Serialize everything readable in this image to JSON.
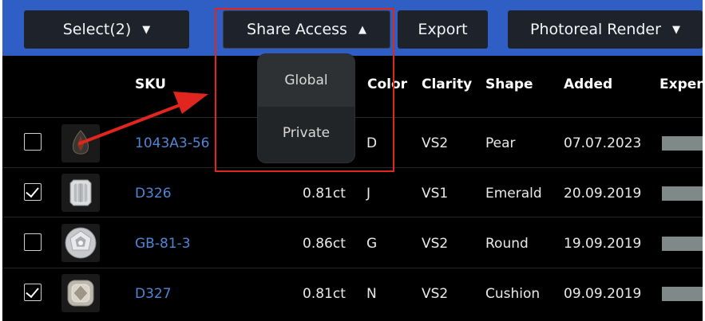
{
  "toolbar": {
    "select_label": "Select(2)",
    "share_label": "Share Access",
    "export_label": "Export",
    "render_label": "Photoreal Render"
  },
  "share_menu": {
    "items": [
      {
        "label": "Global"
      },
      {
        "label": "Private"
      }
    ]
  },
  "table": {
    "columns": {
      "sku": "SKU",
      "color": "Color",
      "clarity": "Clarity",
      "shape": "Shape",
      "added": "Added",
      "expen": "Expen"
    },
    "rows": [
      {
        "checked": false,
        "sku": "1043A3-56",
        "carat": "",
        "color": "D",
        "clarity": "VS2",
        "shape": "Pear",
        "added": "07.07.2023",
        "thumb": "pear-diamond-thumbnail"
      },
      {
        "checked": true,
        "sku": "D326",
        "carat": "0.81ct",
        "color": "J",
        "clarity": "VS1",
        "shape": "Emerald",
        "added": "20.09.2019",
        "thumb": "emerald-diamond-thumbnail"
      },
      {
        "checked": false,
        "sku": "GB-81-3",
        "carat": "0.86ct",
        "color": "G",
        "clarity": "VS2",
        "shape": "Round",
        "added": "19.09.2019",
        "thumb": "round-diamond-thumbnail"
      },
      {
        "checked": true,
        "sku": "D327",
        "carat": "0.81ct",
        "color": "N",
        "clarity": "VS2",
        "shape": "Cushion",
        "added": "09.09.2019",
        "thumb": "cushion-diamond-thumbnail"
      }
    ]
  },
  "colors": {
    "toolbar_bg": "#2f5fc4",
    "button_bg": "#1e232b",
    "sku_link": "#4e86d6",
    "highlight": "#e0261f",
    "expense_bar": "#7f8a88"
  }
}
